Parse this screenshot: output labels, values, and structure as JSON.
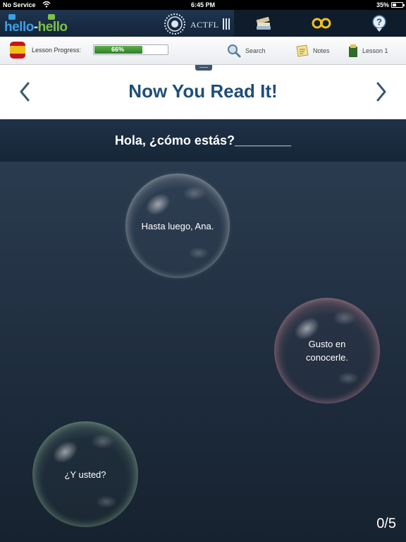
{
  "status_bar": {
    "carrier": "No Service",
    "time": "6:45 PM",
    "battery": "35%"
  },
  "header": {
    "logo": "hello-hello",
    "logo_part1": "hello",
    "logo_dash": "-",
    "logo_part2": "hello",
    "actfl_text": "ACTFL",
    "buttons": [
      {
        "icon": "books-icon"
      },
      {
        "icon": "glasses-icon"
      },
      {
        "icon": "help-icon"
      }
    ]
  },
  "lesson_bar": {
    "language_flag": "spain-flag-icon",
    "progress_label": "Lesson Progress:",
    "progress_text": "66%",
    "progress_value": 0.66,
    "search_label": "Search",
    "notes_label": "Notes",
    "lesson_label": "Lesson 1"
  },
  "title": {
    "text": "Now You Read It!"
  },
  "prompt": {
    "text": "Hola, ¿cómo estás?________"
  },
  "bubbles": [
    {
      "text": "Hasta luego, Ana.",
      "color": "white"
    },
    {
      "text": "Gusto en conocerle.",
      "color": "pink"
    },
    {
      "text": "¿Y usted?",
      "color": "green"
    }
  ],
  "score": "0/5",
  "colors": {
    "title": "#1f4e78",
    "progress": "#3f9236",
    "background": "#1d2b3c"
  }
}
